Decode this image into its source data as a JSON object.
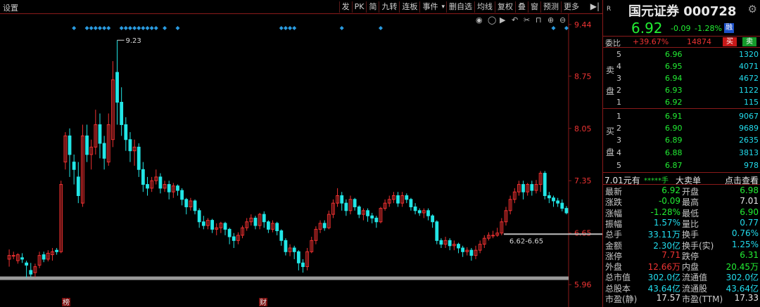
{
  "toolbar": {
    "settings": "设置",
    "items": [
      "发",
      "PK",
      "简",
      "九转",
      "连板",
      "事件",
      "",
      "删自选",
      "均线",
      "复权",
      "叠",
      "窗",
      "预测",
      "更多"
    ],
    "pin_glyph": "▶|"
  },
  "chart_data": {
    "type": "candlestick",
    "ytick_labels": [
      "9.44",
      "8.75",
      "8.05",
      "7.35",
      "6.65",
      "5.96"
    ],
    "yticks": [
      9.44,
      8.75,
      8.05,
      7.35,
      6.65,
      5.96
    ],
    "ylim": [
      5.82,
      9.58
    ],
    "high_annotation": "9.23",
    "high_value": 9.23,
    "range_annotation": "6.62-6.65",
    "range_value": 6.635,
    "gray_band_value": 6.05,
    "bottom_marks": [
      "榜",
      "财"
    ],
    "candles": [
      [
        6.3,
        6.35,
        6.2,
        6.43
      ],
      [
        6.35,
        6.35,
        6.3,
        6.4
      ],
      [
        6.28,
        6.36,
        6.24,
        6.38
      ],
      [
        6.32,
        6.3,
        6.25,
        6.38
      ],
      [
        6.25,
        6.22,
        6.05,
        6.28
      ],
      [
        6.15,
        6.1,
        6.06,
        6.25
      ],
      [
        6.12,
        6.2,
        6.06,
        6.24
      ],
      [
        6.22,
        6.35,
        6.18,
        6.4
      ],
      [
        6.36,
        6.3,
        6.26,
        6.4
      ],
      [
        6.3,
        6.38,
        6.27,
        6.42
      ],
      [
        6.36,
        6.4,
        6.28,
        6.45
      ],
      [
        6.42,
        6.4,
        6.36,
        6.45
      ],
      [
        6.4,
        7.3,
        6.38,
        7.35
      ],
      [
        7.6,
        7.95,
        7.5,
        8.0
      ],
      [
        7.95,
        7.7,
        7.4,
        8.05
      ],
      [
        7.6,
        7.5,
        7.3,
        7.7
      ],
      [
        7.4,
        7.15,
        7.05,
        7.6
      ],
      [
        7.05,
        7.95,
        7.0,
        8.1
      ],
      [
        7.95,
        7.7,
        7.6,
        8.1
      ],
      [
        7.7,
        7.8,
        7.5,
        7.9
      ],
      [
        7.8,
        8.1,
        7.7,
        8.3
      ],
      [
        8.1,
        7.85,
        7.65,
        8.25
      ],
      [
        7.85,
        7.65,
        7.5,
        7.95
      ],
      [
        7.6,
        8.1,
        7.55,
        8.25
      ],
      [
        7.9,
        8.7,
        7.8,
        8.95
      ],
      [
        8.8,
        8.4,
        8.1,
        9.23
      ],
      [
        8.4,
        8.1,
        7.95,
        8.6
      ],
      [
        8.1,
        7.9,
        7.75,
        8.2
      ],
      [
        7.9,
        7.75,
        7.6,
        8.0
      ],
      [
        7.75,
        7.8,
        7.55,
        7.9
      ],
      [
        7.8,
        7.5,
        7.4,
        7.85
      ],
      [
        7.5,
        7.3,
        7.2,
        7.6
      ],
      [
        7.3,
        7.25,
        7.15,
        7.4
      ],
      [
        7.25,
        7.35,
        7.2,
        7.4
      ],
      [
        7.35,
        7.4,
        7.3,
        7.5
      ],
      [
        7.4,
        7.25,
        7.18,
        7.45
      ],
      [
        7.25,
        7.3,
        7.2,
        7.35
      ],
      [
        7.3,
        7.2,
        7.1,
        7.35
      ],
      [
        7.2,
        7.28,
        7.12,
        7.32
      ],
      [
        7.28,
        7.22,
        7.15,
        7.3
      ],
      [
        7.22,
        7.1,
        7.02,
        7.25
      ],
      [
        7.1,
        7.0,
        6.9,
        7.12
      ],
      [
        7.0,
        7.08,
        6.95,
        7.12
      ],
      [
        7.08,
        6.95,
        6.9,
        7.1
      ],
      [
        6.95,
        6.8,
        6.72,
        6.98
      ],
      [
        6.8,
        6.75,
        6.7,
        6.88
      ],
      [
        6.75,
        6.82,
        6.7,
        6.85
      ],
      [
        6.82,
        6.7,
        6.65,
        6.84
      ],
      [
        6.7,
        6.72,
        6.62,
        6.78
      ],
      [
        6.72,
        6.78,
        6.65,
        6.8
      ],
      [
        6.78,
        6.7,
        6.62,
        6.8
      ],
      [
        6.7,
        6.6,
        6.5,
        6.72
      ],
      [
        6.6,
        6.55,
        6.45,
        6.65
      ],
      [
        6.55,
        6.62,
        6.5,
        6.66
      ],
      [
        6.62,
        6.72,
        6.58,
        6.75
      ],
      [
        6.72,
        6.8,
        6.68,
        6.85
      ],
      [
        6.8,
        6.85,
        6.75,
        6.9
      ],
      [
        6.85,
        6.75,
        6.7,
        6.88
      ],
      [
        6.75,
        6.9,
        6.7,
        6.92
      ],
      [
        6.9,
        6.8,
        6.72,
        6.94
      ],
      [
        6.8,
        6.7,
        6.65,
        6.82
      ],
      [
        6.7,
        6.78,
        6.66,
        6.82
      ],
      [
        6.78,
        6.68,
        6.62,
        6.8
      ],
      [
        6.68,
        6.55,
        6.48,
        6.7
      ],
      [
        6.55,
        6.4,
        6.35,
        6.58
      ],
      [
        6.4,
        6.45,
        6.34,
        6.5
      ],
      [
        6.45,
        6.4,
        6.3,
        6.48
      ],
      [
        6.4,
        6.25,
        6.15,
        6.42
      ],
      [
        6.25,
        6.2,
        6.12,
        6.3
      ],
      [
        6.2,
        6.4,
        6.15,
        6.45
      ],
      [
        6.4,
        6.55,
        6.38,
        6.6
      ],
      [
        6.55,
        6.7,
        6.5,
        6.74
      ],
      [
        6.7,
        6.78,
        6.65,
        6.82
      ],
      [
        6.78,
        6.72,
        6.68,
        6.82
      ],
      [
        6.72,
        6.9,
        6.7,
        6.95
      ],
      [
        6.9,
        7.05,
        6.85,
        7.1
      ],
      [
        7.05,
        7.15,
        7.0,
        7.25
      ],
      [
        7.15,
        7.05,
        6.95,
        7.2
      ],
      [
        7.05,
        6.95,
        6.88,
        7.1
      ],
      [
        6.95,
        7.1,
        6.9,
        7.15
      ],
      [
        7.1,
        7.0,
        6.95,
        7.12
      ],
      [
        7.0,
        6.9,
        6.85,
        7.02
      ],
      [
        6.9,
        6.95,
        6.82,
        6.98
      ],
      [
        6.95,
        6.88,
        6.8,
        6.98
      ],
      [
        6.88,
        6.85,
        6.78,
        6.92
      ],
      [
        6.85,
        6.8,
        6.72,
        6.88
      ],
      [
        6.8,
        6.98,
        6.78,
        7.0
      ],
      [
        6.98,
        7.05,
        6.95,
        7.1
      ],
      [
        7.05,
        7.1,
        7.0,
        7.15
      ],
      [
        7.1,
        7.15,
        7.05,
        7.2
      ],
      [
        7.15,
        7.05,
        7.0,
        7.2
      ],
      [
        7.05,
        7.15,
        7.0,
        7.2
      ],
      [
        7.15,
        7.1,
        7.05,
        7.18
      ],
      [
        7.1,
        7.0,
        6.95,
        7.12
      ],
      [
        7.0,
        6.95,
        6.9,
        7.05
      ],
      [
        6.95,
        6.92,
        6.88,
        6.98
      ],
      [
        6.92,
        6.95,
        6.85,
        6.98
      ],
      [
        6.95,
        6.88,
        6.82,
        6.98
      ],
      [
        6.88,
        6.8,
        6.72,
        6.9
      ],
      [
        6.8,
        6.55,
        6.5,
        6.82
      ],
      [
        6.55,
        6.5,
        6.45,
        6.58
      ],
      [
        6.5,
        6.55,
        6.45,
        6.6
      ],
      [
        6.55,
        6.48,
        6.42,
        6.58
      ],
      [
        6.48,
        6.5,
        6.42,
        6.55
      ],
      [
        6.5,
        6.45,
        6.38,
        6.52
      ],
      [
        6.45,
        6.4,
        6.33,
        6.48
      ],
      [
        6.4,
        6.42,
        6.35,
        6.46
      ],
      [
        6.42,
        6.35,
        6.28,
        6.45
      ],
      [
        6.35,
        6.42,
        6.3,
        6.48
      ],
      [
        6.42,
        6.5,
        6.38,
        6.55
      ],
      [
        6.5,
        6.58,
        6.45,
        6.62
      ],
      [
        6.58,
        6.62,
        6.55,
        6.66
      ],
      [
        6.62,
        6.62,
        6.58,
        6.68
      ],
      [
        6.62,
        6.65,
        6.6,
        6.72
      ],
      [
        6.65,
        6.8,
        6.62,
        6.85
      ],
      [
        6.8,
        6.95,
        6.75,
        7.0
      ],
      [
        6.95,
        7.1,
        6.9,
        7.15
      ],
      [
        7.1,
        7.2,
        7.05,
        7.25
      ],
      [
        7.2,
        7.3,
        7.15,
        7.35
      ],
      [
        7.3,
        7.2,
        7.1,
        7.35
      ],
      [
        7.2,
        7.3,
        7.15,
        7.32
      ],
      [
        7.3,
        7.22,
        7.15,
        7.35
      ],
      [
        7.22,
        7.3,
        7.18,
        7.36
      ],
      [
        7.3,
        7.45,
        7.2,
        7.48
      ],
      [
        7.45,
        7.15,
        7.1,
        7.48
      ],
      [
        7.15,
        7.12,
        7.05,
        7.2
      ],
      [
        7.12,
        7.08,
        7.0,
        7.15
      ],
      [
        7.08,
        7.05,
        7.0,
        7.12
      ],
      [
        7.05,
        6.98,
        6.94,
        7.1
      ],
      [
        6.98,
        6.92,
        6.9,
        7.01
      ]
    ],
    "markers_idx": [
      15,
      18,
      19,
      20,
      21,
      22,
      23,
      26,
      27,
      28,
      29,
      30,
      31,
      32,
      33,
      34,
      36,
      39,
      63,
      64,
      65,
      66,
      77,
      86,
      126,
      129
    ]
  },
  "quote": {
    "r_badge": "R",
    "name_code": "国元证券 000728",
    "last": "6.92",
    "change": "-0.09",
    "change_pct": "-1.28%",
    "rong": "融",
    "weibi_label": "委比",
    "weibi_pct": "+39.67%",
    "weibi_vol": "14874",
    "buy_label": "买",
    "sell_label": "卖",
    "sell_side_label": [
      "卖",
      "盘"
    ],
    "buy_side_label": [
      "买",
      "盘"
    ],
    "asks": [
      {
        "level": "5",
        "price": "6.96",
        "vol": "1320"
      },
      {
        "level": "4",
        "price": "6.95",
        "vol": "4071"
      },
      {
        "level": "3",
        "price": "6.94",
        "vol": "4672"
      },
      {
        "level": "2",
        "price": "6.93",
        "vol": "1122"
      },
      {
        "level": "1",
        "price": "6.92",
        "vol": "115"
      }
    ],
    "bids": [
      {
        "level": "1",
        "price": "6.91",
        "vol": "9067"
      },
      {
        "level": "2",
        "price": "6.90",
        "vol": "9689"
      },
      {
        "level": "3",
        "price": "6.89",
        "vol": "2635"
      },
      {
        "level": "4",
        "price": "6.88",
        "vol": "3813"
      },
      {
        "level": "5",
        "price": "6.87",
        "vol": "978"
      }
    ],
    "bigorder": {
      "price": "7.01元有",
      "stars": "*****手",
      "title": "大卖单",
      "link": "点击查看"
    },
    "stats": [
      {
        "l1": "最新",
        "v1": "6.92",
        "c1": "green",
        "l2": "开盘",
        "v2": "6.98",
        "c2": "green"
      },
      {
        "l1": "涨跌",
        "v1": "-0.09",
        "c1": "green",
        "l2": "最高",
        "v2": "7.01",
        "c2": "white"
      },
      {
        "l1": "涨幅",
        "v1": "-1.28%",
        "c1": "green",
        "l2": "最低",
        "v2": "6.90",
        "c2": "green"
      },
      {
        "l1": "振幅",
        "v1": "1.57%",
        "c1": "cyan",
        "l2": "量比",
        "v2": "0.77",
        "c2": "cyan"
      },
      {
        "l1": "总手",
        "v1": "33.11万",
        "c1": "cyan",
        "l2": "换手",
        "v2": "0.76%",
        "c2": "cyan"
      },
      {
        "l1": "金额",
        "v1": "2.30亿",
        "c1": "cyan",
        "l2": "换手(实)",
        "v2": "1.25%",
        "c2": "cyan"
      },
      {
        "l1": "涨停",
        "v1": "7.71",
        "c1": "red",
        "l2": "跌停",
        "v2": "6.31",
        "c2": "green"
      },
      {
        "l1": "外盘",
        "v1": "12.66万",
        "c1": "red",
        "l2": "内盘",
        "v2": "20.45万",
        "c2": "green"
      },
      {
        "l1": "总市值",
        "v1": "302.0亿",
        "c1": "cyan",
        "l2": "流通值",
        "v2": "302.0亿",
        "c2": "cyan"
      },
      {
        "l1": "总股本",
        "v1": "43.64亿",
        "c1": "cyan",
        "l2": "流通股",
        "v2": "43.64亿",
        "c2": "cyan"
      },
      {
        "l1": "市盈(静)",
        "v1": "17.57",
        "c1": "white",
        "l2": "市盈(TTM)",
        "v2": "17.33",
        "c2": "white"
      }
    ]
  },
  "colors": {
    "up": "#ee3030",
    "down": "#22e6e6",
    "frame": "#8a1a1a",
    "marker": "#2a9be0",
    "axis_text": "#ee3333"
  }
}
